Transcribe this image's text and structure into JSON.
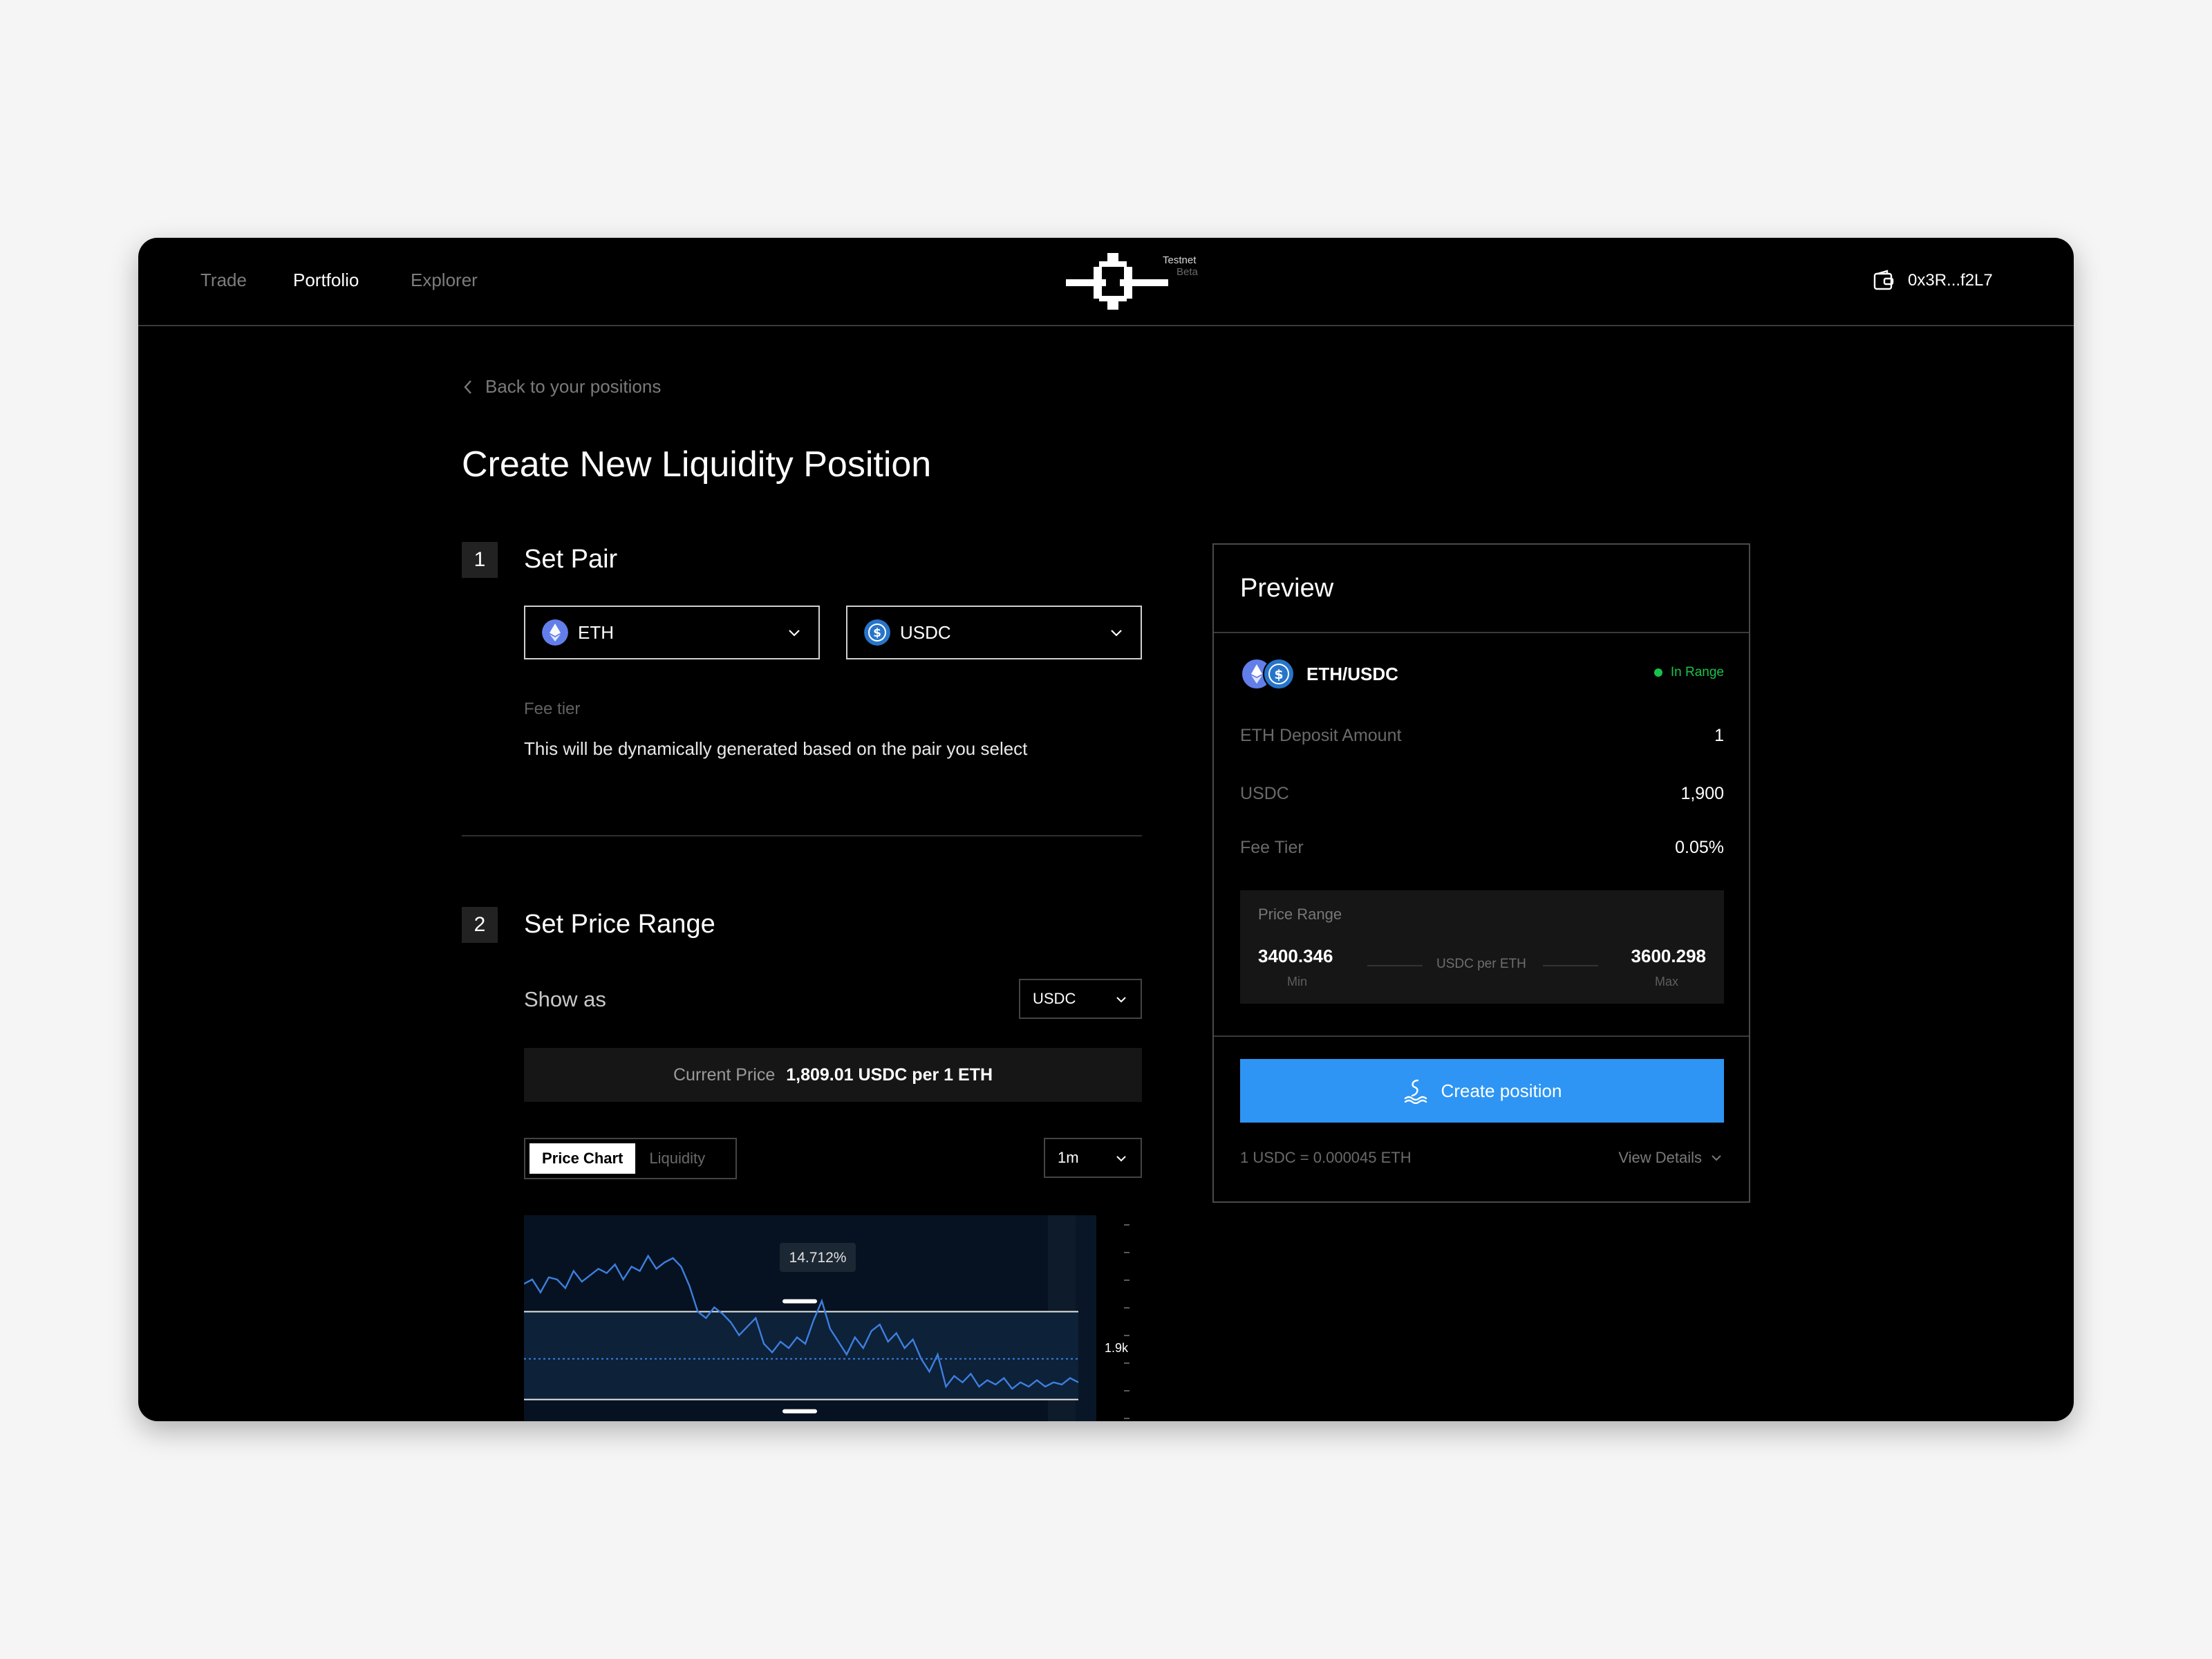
{
  "nav": {
    "items": [
      "Trade",
      "Portfolio",
      "Explorer"
    ],
    "active": "Portfolio"
  },
  "brand": {
    "tag1": "Testnet",
    "tag2": "Beta"
  },
  "wallet": {
    "address": "0x3R...f2L7",
    "icon": "wallet-icon"
  },
  "back_link": "Back to  your positions",
  "page_title": "Create New Liquidity Position",
  "step1": {
    "number": "1",
    "title": "Set Pair",
    "token_a": "ETH",
    "token_b": "USDC",
    "fee_label": "Fee tier",
    "fee_desc": "This will be dynamically generated based on the pair you select"
  },
  "step2": {
    "number": "2",
    "title": "Set Price Range",
    "show_as_label": "Show as",
    "show_as_value": "USDC",
    "current_price_label": "Current Price",
    "current_price_value": "1,809.01 USDC per 1 ETH",
    "tabs": [
      "Price Chart",
      "Liquidity"
    ],
    "active_tab": "Price Chart",
    "timeframe": "1m"
  },
  "chart_data": {
    "type": "line",
    "percent_label": "14.712%",
    "price_tick_label": "1.9k",
    "series": [
      {
        "values": [
          0.68,
          0.7,
          0.64,
          0.71,
          0.7,
          0.66,
          0.74,
          0.69,
          0.72,
          0.75,
          0.73,
          0.77,
          0.7,
          0.76,
          0.74,
          0.81,
          0.75,
          0.78,
          0.8,
          0.76,
          0.67,
          0.55,
          0.52,
          0.57,
          0.54,
          0.5,
          0.44,
          0.48,
          0.52,
          0.4,
          0.36,
          0.41,
          0.38,
          0.43,
          0.4,
          0.51,
          0.6,
          0.47,
          0.41,
          0.35,
          0.43,
          0.38,
          0.46,
          0.49,
          0.41,
          0.45,
          0.38,
          0.42,
          0.33,
          0.27,
          0.35,
          0.2,
          0.25,
          0.22,
          0.26,
          0.2,
          0.23,
          0.21,
          0.24,
          0.19,
          0.22,
          0.2,
          0.23,
          0.2,
          0.22,
          0.21,
          0.24,
          0.22
        ]
      }
    ],
    "range_upper": 0.55,
    "range_lower": 0.14,
    "current_line": 0.33,
    "colors": {
      "line": "#3d7fe0",
      "band": "#0d2138",
      "bg": "#061221"
    }
  },
  "preview": {
    "title": "Preview",
    "pair": "ETH/USDC",
    "status": "In Range",
    "rows": [
      {
        "label": "ETH Deposit Amount",
        "value": "1"
      },
      {
        "label": "USDC",
        "value": "1,900"
      },
      {
        "label": "Fee Tier",
        "value": "0.05%"
      }
    ],
    "price_range_label": "Price Range",
    "min_value": "3400.346",
    "min_label": "Min",
    "max_value": "3600.298",
    "max_label": "Max",
    "unit": "USDC per ETH",
    "create_button": "Create position",
    "rate": "1 USDC = 0.000045 ETH",
    "view_details": "View Details"
  },
  "colors": {
    "accent": "#2e95f4",
    "in_range": "#19c24a",
    "eth": "#627eea",
    "usdc": "#2775ca"
  }
}
